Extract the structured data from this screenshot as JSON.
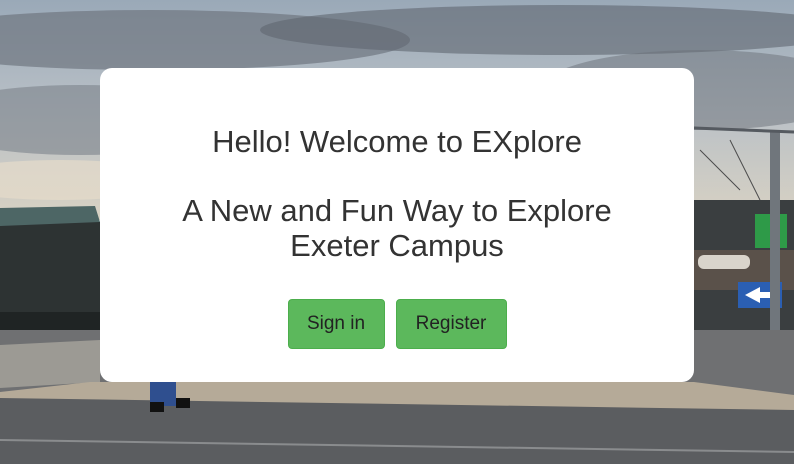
{
  "welcome": {
    "greeting": "Hello! Welcome to EXplore",
    "tagline": "A New and Fun Way to Explore Exeter Campus"
  },
  "actions": {
    "sign_in_label": "Sign in",
    "register_label": "Register"
  },
  "colors": {
    "button_green": "#5cb85c",
    "card_background": "#ffffff",
    "text": "#333333"
  }
}
